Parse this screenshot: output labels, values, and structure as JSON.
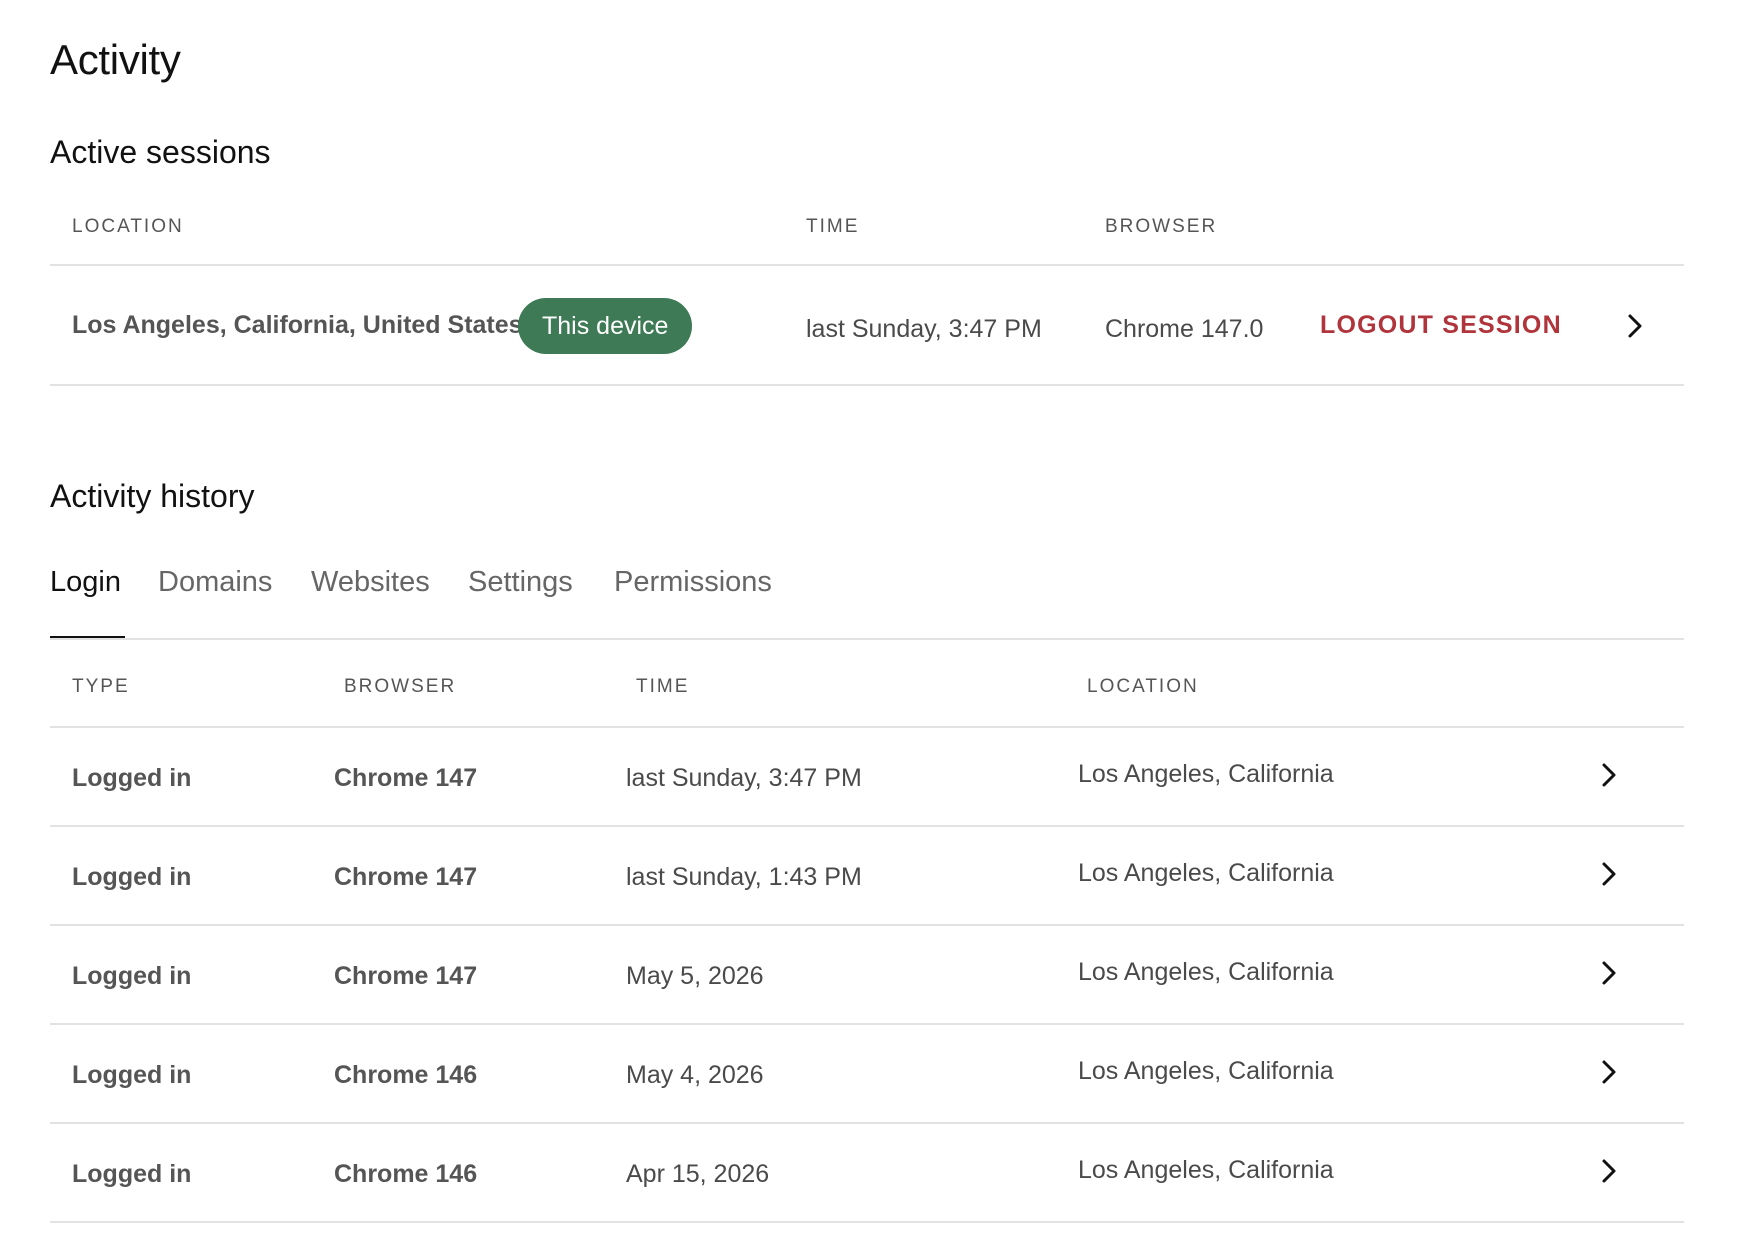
{
  "page": {
    "title": "Activity"
  },
  "active_sessions": {
    "title": "Active sessions",
    "headers": {
      "location": "LOCATION",
      "time": "TIME",
      "browser": "BROWSER"
    },
    "session": {
      "location": "Los Angeles, California, United States",
      "badge": "This device",
      "time": "last Sunday, 3:47 PM",
      "browser": "Chrome 147.0",
      "logout_label": "LOGOUT SESSION"
    }
  },
  "activity_history": {
    "title": "Activity history",
    "tabs": [
      {
        "label": "Login",
        "active": true
      },
      {
        "label": "Domains",
        "active": false
      },
      {
        "label": "Websites",
        "active": false
      },
      {
        "label": "Settings",
        "active": false
      },
      {
        "label": "Permissions",
        "active": false
      }
    ],
    "headers": {
      "type": "TYPE",
      "browser": "BROWSER",
      "time": "TIME",
      "location": "LOCATION"
    },
    "rows": [
      {
        "type": "Logged in",
        "browser": "Chrome 147",
        "time": "last Sunday, 3:47 PM",
        "location": "Los Angeles, California"
      },
      {
        "type": "Logged in",
        "browser": "Chrome 147",
        "time": "last Sunday, 1:43 PM",
        "location": "Los Angeles, California"
      },
      {
        "type": "Logged in",
        "browser": "Chrome 147",
        "time": "May 5, 2026",
        "location": "Los Angeles, California"
      },
      {
        "type": "Logged in",
        "browser": "Chrome 146",
        "time": "May 4, 2026",
        "location": "Los Angeles, California"
      },
      {
        "type": "Logged in",
        "browser": "Chrome 146",
        "time": "Apr 15, 2026",
        "location": "Los Angeles, California"
      }
    ]
  },
  "colors": {
    "badge_bg": "#3d7a55",
    "logout": "#b0343c",
    "divider": "#e2e2e2",
    "active_tab_underline": "#111111"
  },
  "icons": {
    "row_action": "chevron-right-icon"
  }
}
